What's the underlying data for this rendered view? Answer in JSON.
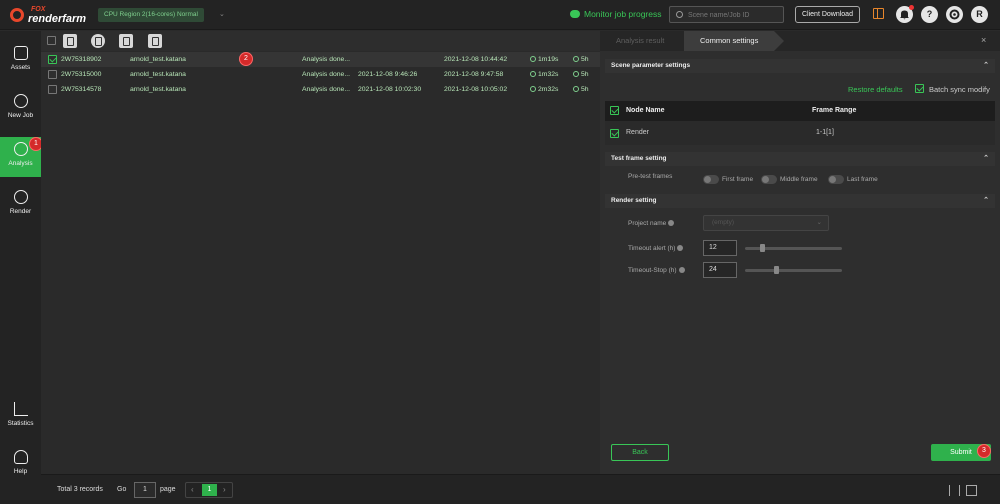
{
  "header": {
    "logo_top": "FOX",
    "logo_bottom": "renderfarm",
    "region": "CPU Region 2(16-cores)   Normal",
    "region_caret": "⌄",
    "monitor": "Monitor job progress",
    "search_placeholder": "Scene name/Job ID",
    "client_download": "Client Download",
    "help": "?",
    "avatar": "R"
  },
  "sidebar": {
    "items": [
      {
        "label": "Assets"
      },
      {
        "label": "New Job"
      },
      {
        "label": "Analysis"
      },
      {
        "label": "Render"
      },
      {
        "label": "Statistics"
      },
      {
        "label": "Help"
      }
    ],
    "badge": "1"
  },
  "jobs": {
    "rows": [
      {
        "id": "2W75318902",
        "scene": "arnold_test.katana",
        "status": "Analysis done...",
        "start": "",
        "end": "2021-12-08 10:44:42",
        "duration": "1m19s",
        "timeout": "5h"
      },
      {
        "id": "2W75315000",
        "scene": "arnold_test.katana",
        "status": "Analysis done...",
        "start": "2021-12-08 9:46:26",
        "end": "2021-12-08 9:47:58",
        "duration": "1m32s",
        "timeout": "5h"
      },
      {
        "id": "2W75314578",
        "scene": "arnold_test.katana",
        "status": "Analysis done...",
        "start": "2021-12-08 10:02:30",
        "end": "2021-12-08 10:05:02",
        "duration": "2m32s",
        "timeout": "5h"
      }
    ],
    "row_badge": "2"
  },
  "footer": {
    "total": "Total 3 records",
    "go": "Go",
    "page_input": "1",
    "page_word": "page",
    "current_page": "1",
    "prev": "‹",
    "next": "›"
  },
  "panel": {
    "tab_inactive": "Analysis result",
    "tab_active": "Common settings",
    "close": "×",
    "scene_section": "Scene parameter settings",
    "restore": "Restore defaults",
    "batch_sync": "Batch sync modify",
    "node_header": "Node Name",
    "frame_header": "Frame Range",
    "node_name": "Render",
    "frame_range": "1-1[1]",
    "test_section": "Test frame setting",
    "pretest_label": "Pre-test frames",
    "first_frame": "First frame",
    "middle_frame": "Middle frame",
    "last_frame": "Last frame",
    "render_section": "Render setting",
    "project_label": "Project name",
    "project_value": "(empty)",
    "timeout_alert_label": "Timeout alert (h)",
    "timeout_alert_value": "12",
    "timeout_alert_level": 0.15,
    "timeout_stop_label": "Timeout-Stop (h)",
    "timeout_stop_value": "24",
    "timeout_stop_level": 0.3,
    "back": "Back",
    "submit": "Submit",
    "submit_badge": "3",
    "chevron": "⌃"
  }
}
